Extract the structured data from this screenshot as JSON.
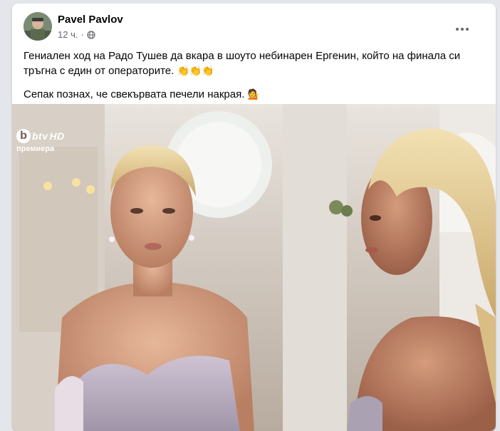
{
  "post": {
    "author": "Pavel Pavlov",
    "time": "12 ч.",
    "separator": "·",
    "privacy_icon": "globe-icon",
    "menu_icon": "more-options-icon",
    "text_line1": "Гениален ход на Радо Тушев да вкара в шоуто небинарен Ергенин, който на финала си тръгна с един от операторите.",
    "emoji1": "👏👏👏",
    "text_line2": "Сепак познах, че свекървата печели накрая.",
    "emoji2": "💁"
  },
  "media": {
    "channel_logo": "btv",
    "channel_suffix": "HD",
    "overlay_label": "премиера"
  }
}
